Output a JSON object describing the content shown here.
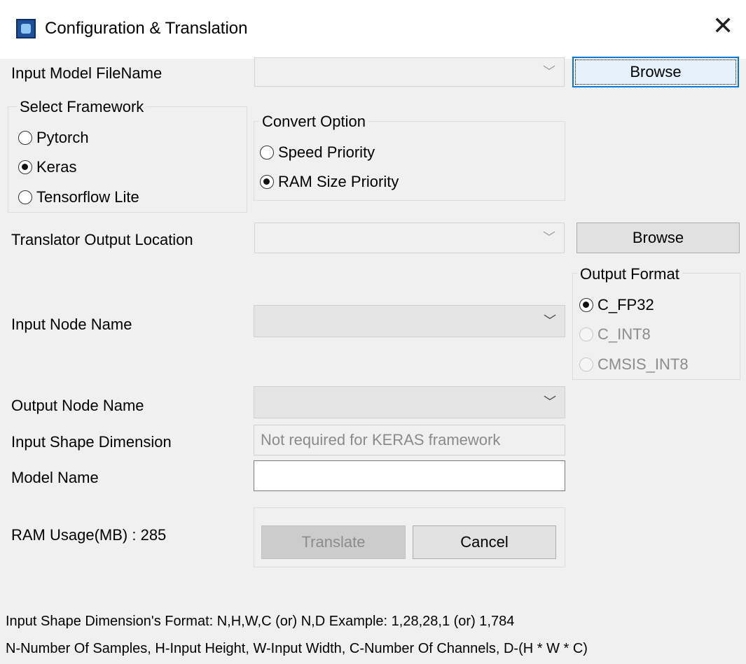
{
  "window": {
    "title": "Configuration & Translation"
  },
  "input_model": {
    "label": "Input Model FileName",
    "value": "",
    "browse_label": "Browse"
  },
  "framework": {
    "legend": "Select Framework",
    "options": [
      "Pytorch",
      "Keras",
      "Tensorflow Lite"
    ],
    "selected": "Keras"
  },
  "convert": {
    "legend": "Convert Option",
    "options": [
      "Speed Priority",
      "RAM Size Priority"
    ],
    "selected": "RAM Size Priority"
  },
  "output_location": {
    "label": "Translator Output Location",
    "value": "",
    "browse_label": "Browse"
  },
  "output_format": {
    "legend": "Output Format",
    "options": [
      "C_FP32",
      "C_INT8",
      "CMSIS_INT8"
    ],
    "selected": "C_FP32"
  },
  "input_node": {
    "label": "Input Node Name",
    "value": ""
  },
  "output_node": {
    "label": "Output Node Name",
    "value": ""
  },
  "input_shape": {
    "label": "Input Shape Dimension",
    "placeholder": "Not required for KERAS framework"
  },
  "model_name": {
    "label": "Model Name",
    "value": ""
  },
  "ram_usage": {
    "text": "RAM Usage(MB) : 285"
  },
  "actions": {
    "translate_label": "Translate",
    "cancel_label": "Cancel"
  },
  "footer": {
    "line1": "Input Shape Dimension's Format: N,H,W,C (or) N,D     Example: 1,28,28,1 (or) 1,784",
    "line2": "N-Number Of Samples, H-Input Height, W-Input Width, C-Number Of Channels, D-(H * W * C)"
  }
}
